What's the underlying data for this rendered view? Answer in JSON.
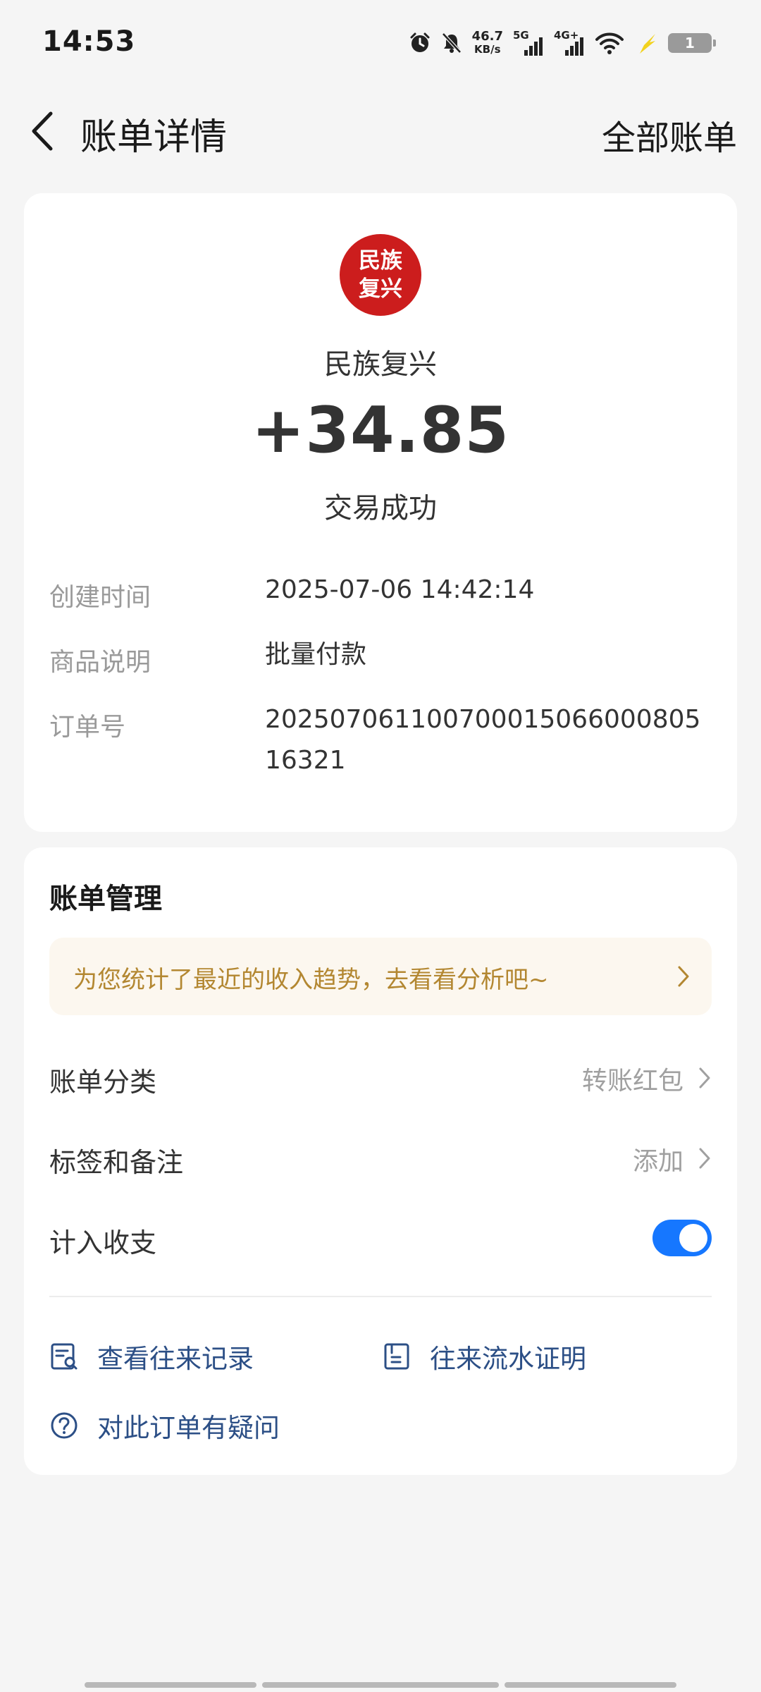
{
  "status_bar": {
    "time": "14:53",
    "net_speed_value": "46.7",
    "net_speed_unit": "KB/s",
    "sig1_label": "5G",
    "sig2_label": "4G+",
    "battery": "1",
    "icons": [
      "alarm-icon",
      "mute-icon",
      "signal-5g-icon",
      "signal-4g-icon",
      "wifi-icon",
      "charging-icon",
      "battery-icon"
    ]
  },
  "nav": {
    "title": "账单详情",
    "right_link": "全部账单"
  },
  "transaction": {
    "logo_text": "民族复兴",
    "merchant": "民族复兴",
    "amount": "+34.85",
    "status": "交易成功",
    "details": [
      {
        "label": "创建时间",
        "value": "2025-07-06 14:42:14"
      },
      {
        "label": "商品说明",
        "value": "批量付款"
      },
      {
        "label": "订单号",
        "value": "20250706110070001506600080516321"
      }
    ]
  },
  "management": {
    "title": "账单管理",
    "tip": "为您统计了最近的收入趋势，去看看分析吧~",
    "rows": [
      {
        "label": "账单分类",
        "value": "转账红包"
      },
      {
        "label": "标签和备注",
        "value": "添加"
      },
      {
        "label": "计入收支",
        "toggle": true
      }
    ],
    "links": [
      {
        "label": "查看往来记录",
        "icon": "record-search-icon"
      },
      {
        "label": "往来流水证明",
        "icon": "statement-icon"
      },
      {
        "label": "对此订单有疑问",
        "icon": "question-icon"
      }
    ]
  },
  "colors": {
    "accent": "#1677ff",
    "link": "#2c4f86",
    "tip_text": "#b38731",
    "tip_bg": "#fcf7ef",
    "logo_bg": "#cc1d1d"
  }
}
